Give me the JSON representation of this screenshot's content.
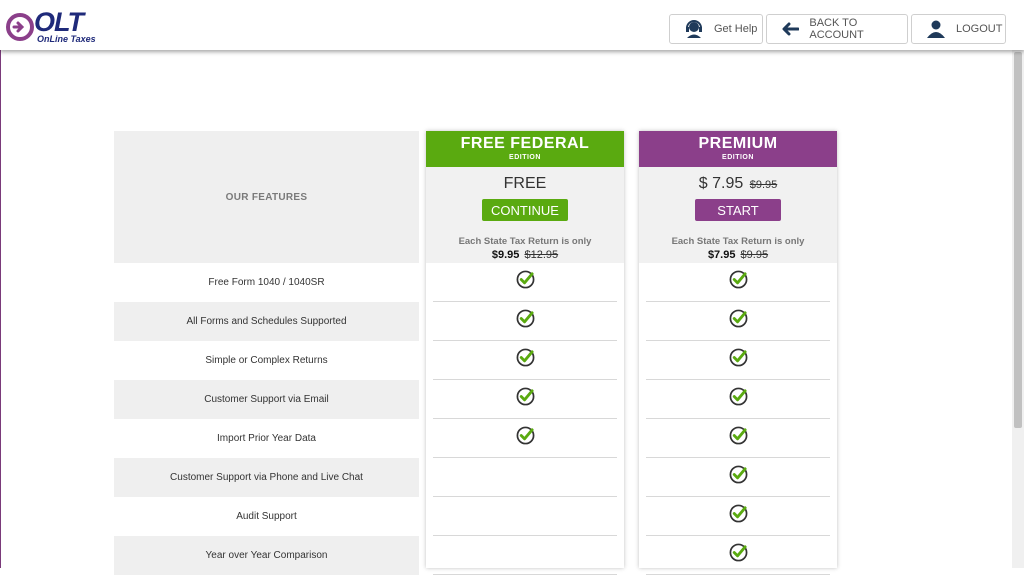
{
  "header": {
    "logo_text": "OLT",
    "logo_subtitle": "OnLine Taxes",
    "help_label": "Get Help",
    "back_label": "BACK TO ACCOUNT",
    "logout_label": "LOGOUT",
    "brand_color": "#1f2a7a"
  },
  "features_heading": "OUR FEATURES",
  "plans": [
    {
      "title": "FREE FEDERAL",
      "edition": "EDITION",
      "price": "FREE",
      "old_price": "",
      "cta_label": "CONTINUE",
      "state_note": "Each State Tax Return is only",
      "state_price": "$9.95",
      "state_old_price": "$12.95",
      "color": "#5aaa10"
    },
    {
      "title": "PREMIUM",
      "edition": "EDITION",
      "price": "$ 7.95",
      "old_price": "$9.95",
      "cta_label": "START",
      "state_note": "Each State Tax Return is only",
      "state_price": "$7.95",
      "state_old_price": "$9.95",
      "color": "#8b3f8a"
    }
  ],
  "features": [
    {
      "label": "Free Form 1040 / 1040SR",
      "free": true,
      "premium": true
    },
    {
      "label": "All Forms and Schedules Supported",
      "free": true,
      "premium": true
    },
    {
      "label": "Simple or Complex Returns",
      "free": true,
      "premium": true
    },
    {
      "label": "Customer Support via Email",
      "free": true,
      "premium": true
    },
    {
      "label": "Import Prior Year Data",
      "free": true,
      "premium": true
    },
    {
      "label": "Customer Support via Phone and Live Chat",
      "free": false,
      "premium": true
    },
    {
      "label": "Audit Support",
      "free": false,
      "premium": true
    },
    {
      "label": "Year over Year Comparison",
      "free": false,
      "premium": true
    }
  ]
}
